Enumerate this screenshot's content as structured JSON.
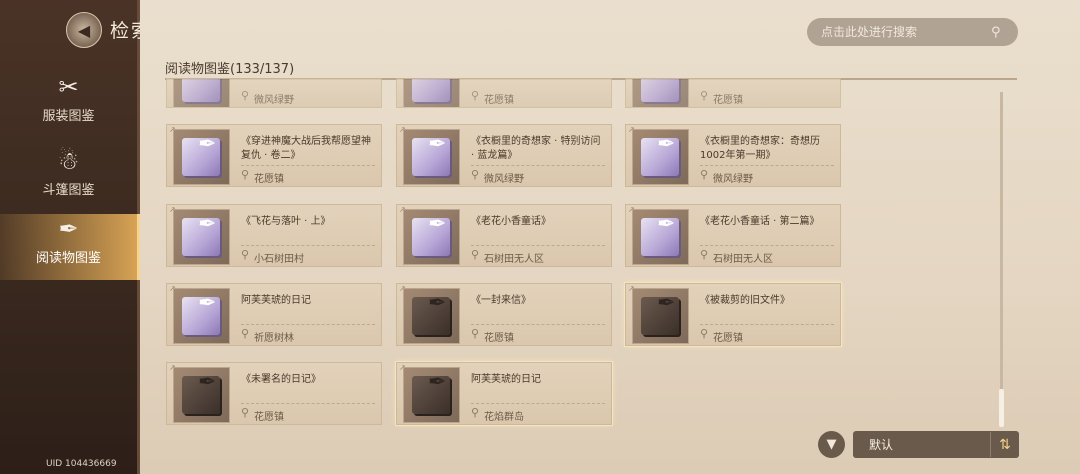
{
  "header": {
    "title": "检索"
  },
  "sidebar": {
    "items": [
      {
        "label": "服装图鉴",
        "icon": "outfit-icon",
        "glyph": "✂"
      },
      {
        "label": "斗篷图鉴",
        "icon": "cloak-icon",
        "glyph": "☃"
      },
      {
        "label": "阅读物图鉴",
        "icon": "quill-icon",
        "glyph": "✒"
      }
    ],
    "active_index": 2
  },
  "uid": "UID 104436669",
  "search": {
    "placeholder": "点击此处进行搜索",
    "icon": "search-icon"
  },
  "section": {
    "title": "阅读物图鉴(133/137)"
  },
  "cards_partial": [
    {
      "title": "",
      "location": "微风绿野"
    },
    {
      "title": "",
      "location": "花愿镇"
    },
    {
      "title": "",
      "location": "花愿镇"
    }
  ],
  "cards": [
    {
      "title": "《穿进神魔大战后我帮愿望神复仇 · 卷二》",
      "location": "花愿镇",
      "dark": false
    },
    {
      "title": "《衣橱里的奇想家 · 特别访问 · 蓝龙篇》",
      "location": "微风绿野",
      "dark": false
    },
    {
      "title": "《衣橱里的奇想家：奇想历1002年第一期》",
      "location": "微风绿野",
      "dark": false
    },
    {
      "title": "《飞花与落叶 · 上》",
      "location": "小石树田村",
      "dark": false
    },
    {
      "title": "《老花小香童话》",
      "location": "石树田无人区",
      "dark": false
    },
    {
      "title": "《老花小香童话 · 第二篇》",
      "location": "石树田无人区",
      "dark": false
    },
    {
      "title": "阿芙芙琥的日记",
      "location": "祈愿树林",
      "dark": false
    },
    {
      "title": "《一封来信》",
      "location": "花愿镇",
      "dark": true
    },
    {
      "title": "《被裁剪的旧文件》",
      "location": "花愿镇",
      "dark": true
    },
    {
      "title": "《未署名的日记》",
      "location": "花愿镇",
      "dark": true
    },
    {
      "title": "阿芙芙琥的日记",
      "location": "花焰群岛",
      "dark": true
    }
  ],
  "bottom": {
    "sort_label": "默认",
    "filter_icon": "filter-icon",
    "sort_order_icon": "sort-order-icon"
  }
}
